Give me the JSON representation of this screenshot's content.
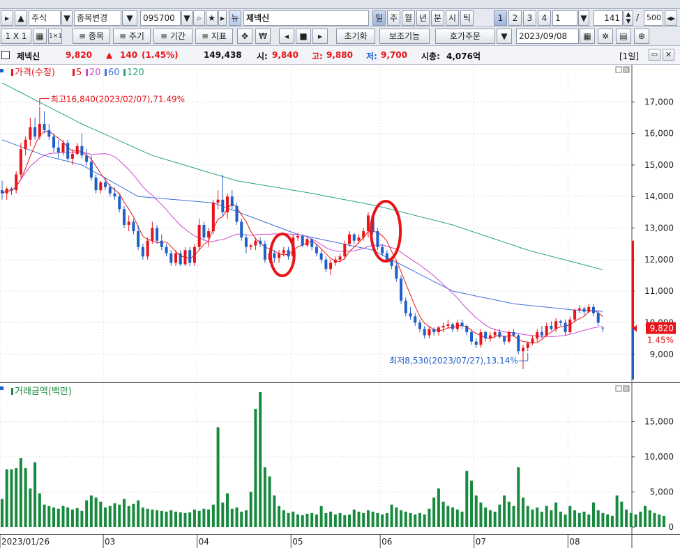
{
  "toolbar": {
    "market": "주식",
    "change_stock": "종목변경",
    "code": "095700",
    "name": "제넥신",
    "periods": [
      "일",
      "주",
      "월",
      "년",
      "분",
      "시",
      "틱"
    ],
    "num_buttons": [
      "1",
      "2",
      "3",
      "4"
    ],
    "interval": "1",
    "count": "141",
    "page_total": "500",
    "slash": "/"
  },
  "toolbar2": {
    "layout": "1 X 1",
    "stock": "종목",
    "cycle": "주기",
    "period": "기간",
    "indicator": "지표",
    "reset": "초기화",
    "aux": "보조기능",
    "order": "호가주문",
    "date": "2023/09/08"
  },
  "info": {
    "name": "제넥신",
    "price": "9,820",
    "arrow": "▲",
    "change": "140",
    "pct": "(1.45%)",
    "volume": "149,438",
    "open_label": "시:",
    "open": "9,840",
    "high_label": "고:",
    "high": "9,880",
    "low_label": "저:",
    "low": "9,700",
    "cap_label": "시총:",
    "cap": "4,076억",
    "period_tag": "[1일]"
  },
  "legend_price": {
    "title": "가격(수정)",
    "ma": [
      "5",
      "20",
      "60",
      "120"
    ]
  },
  "legend_volume": {
    "title": "거래금액(백만)"
  },
  "annotations": {
    "high": "최고16,840(2023/02/07),71.49%",
    "low": "최저8,530(2023/07/27),13.14%"
  },
  "current": {
    "price": "9,820",
    "pct": "1.45%"
  },
  "colors": {
    "up": "#e8141a",
    "down": "#1f5fc8",
    "ma5": "#e8141a",
    "ma20": "#d048d0",
    "ma60": "#3f73d8",
    "ma120": "#26a37b",
    "volume": "#178a3e"
  },
  "chart_data": [
    {
      "type": "candlestick",
      "title": "가격(수정)",
      "x_ticks": [
        "2023/01/26",
        "03",
        "04",
        "05",
        "06",
        "07",
        "08"
      ],
      "y_ticks": [
        "9,000",
        "10,000",
        "11,000",
        "12,000",
        "13,000",
        "14,000",
        "15,000",
        "16,000",
        "17,000"
      ],
      "ylim": [
        8200,
        18000
      ],
      "ohlc": [
        [
          14200,
          14500,
          13900,
          14100
        ],
        [
          14100,
          14300,
          13900,
          14250
        ],
        [
          14250,
          14300,
          14050,
          14200
        ],
        [
          14200,
          14800,
          14100,
          14700
        ],
        [
          14700,
          15700,
          14600,
          15500
        ],
        [
          15500,
          15900,
          15300,
          15800
        ],
        [
          15800,
          16500,
          15600,
          16200
        ],
        [
          16200,
          16500,
          15800,
          15900
        ],
        [
          15900,
          16840,
          15800,
          16300
        ],
        [
          16300,
          16700,
          16000,
          16100
        ],
        [
          16100,
          16300,
          15800,
          15900
        ],
        [
          15900,
          16000,
          15400,
          15550
        ],
        [
          15550,
          15800,
          15200,
          15400
        ],
        [
          15400,
          15800,
          15300,
          15700
        ],
        [
          15700,
          15800,
          15100,
          15200
        ],
        [
          15200,
          15500,
          15000,
          15350
        ],
        [
          15350,
          15700,
          15300,
          15600
        ],
        [
          15600,
          16000,
          15200,
          15300
        ],
        [
          15300,
          15500,
          15000,
          15100
        ],
        [
          15100,
          15300,
          14500,
          14600
        ],
        [
          14600,
          14700,
          14100,
          14200
        ],
        [
          14200,
          14500,
          14100,
          14450
        ],
        [
          14450,
          14600,
          14200,
          14300
        ],
        [
          14300,
          14400,
          14000,
          14100
        ],
        [
          14100,
          14300,
          13900,
          14000
        ],
        [
          14000,
          14100,
          13500,
          13600
        ],
        [
          13600,
          13700,
          13000,
          13100
        ],
        [
          13100,
          13400,
          12900,
          13200
        ],
        [
          13200,
          13300,
          12800,
          12900
        ],
        [
          12900,
          13100,
          12300,
          12400
        ],
        [
          12400,
          12500,
          12000,
          12100
        ],
        [
          12100,
          12700,
          12000,
          12600
        ],
        [
          12600,
          13200,
          12500,
          13000
        ],
        [
          13000,
          13100,
          12500,
          12600
        ],
        [
          12600,
          12800,
          12300,
          12400
        ],
        [
          12400,
          12500,
          12100,
          12200
        ],
        [
          12200,
          12300,
          11800,
          11900
        ],
        [
          11900,
          12300,
          11800,
          12200
        ],
        [
          12200,
          12300,
          11800,
          11850
        ],
        [
          11850,
          12400,
          11800,
          12300
        ],
        [
          12300,
          12400,
          11800,
          11900
        ],
        [
          11900,
          12500,
          11800,
          12400
        ],
        [
          12400,
          13300,
          12300,
          13100
        ],
        [
          13100,
          13200,
          12600,
          12700
        ],
        [
          12700,
          13000,
          12400,
          12900
        ],
        [
          12900,
          13900,
          12800,
          13800
        ],
        [
          13800,
          14200,
          13600,
          13900
        ],
        [
          13900,
          14700,
          13400,
          13500
        ],
        [
          13500,
          14100,
          13300,
          14000
        ],
        [
          14000,
          14200,
          13600,
          13700
        ],
        [
          13700,
          13800,
          13100,
          13200
        ],
        [
          13200,
          13300,
          12600,
          12700
        ],
        [
          12700,
          12800,
          12200,
          12400
        ],
        [
          12400,
          12500,
          12300,
          12450
        ],
        [
          12450,
          12700,
          12300,
          12600
        ],
        [
          12600,
          12700,
          12400,
          12500
        ],
        [
          12500,
          12600,
          11900,
          12000
        ],
        [
          12000,
          12300,
          11900,
          12200
        ],
        [
          12200,
          12300,
          11900,
          12050
        ],
        [
          12050,
          12300,
          11900,
          12200
        ],
        [
          12200,
          12400,
          12100,
          12300
        ],
        [
          12300,
          12400,
          12000,
          12100
        ],
        [
          12100,
          12800,
          12050,
          12700
        ],
        [
          12700,
          12850,
          12600,
          12750
        ],
        [
          12750,
          12800,
          12400,
          12450
        ],
        [
          12450,
          12700,
          12400,
          12650
        ],
        [
          12650,
          12700,
          12300,
          12400
        ],
        [
          12400,
          12500,
          12100,
          12200
        ],
        [
          12200,
          12300,
          11900,
          12000
        ],
        [
          12000,
          12100,
          11600,
          11700
        ],
        [
          11700,
          12000,
          11500,
          11900
        ],
        [
          11900,
          12100,
          11800,
          12000
        ],
        [
          12000,
          12200,
          11900,
          12100
        ],
        [
          12100,
          12600,
          12000,
          12500
        ],
        [
          12500,
          12900,
          12400,
          12800
        ],
        [
          12800,
          12850,
          12500,
          12600
        ],
        [
          12600,
          12800,
          12500,
          12700
        ],
        [
          12700,
          13000,
          12600,
          12900
        ],
        [
          12900,
          13500,
          12700,
          13400
        ],
        [
          13400,
          13450,
          12800,
          12900
        ],
        [
          12900,
          13000,
          12300,
          12400
        ],
        [
          12400,
          12500,
          12100,
          12200
        ],
        [
          12200,
          12300,
          11900,
          12000
        ],
        [
          12000,
          12100,
          11700,
          11800
        ],
        [
          11800,
          11900,
          11300,
          11400
        ],
        [
          11400,
          11500,
          10600,
          10700
        ],
        [
          10700,
          10800,
          10200,
          10300
        ],
        [
          10300,
          10500,
          10100,
          10200
        ],
        [
          10200,
          10300,
          9900,
          10000
        ],
        [
          10000,
          10100,
          9700,
          9800
        ],
        [
          9800,
          9900,
          9500,
          9600
        ],
        [
          9600,
          9900,
          9500,
          9800
        ],
        [
          9800,
          9850,
          9600,
          9700
        ],
        [
          9700,
          9900,
          9600,
          9850
        ],
        [
          9850,
          10000,
          9700,
          9900
        ],
        [
          9900,
          10100,
          9800,
          9950
        ],
        [
          9950,
          10000,
          9700,
          9800
        ],
        [
          9800,
          10100,
          9700,
          10000
        ],
        [
          10000,
          10100,
          9800,
          9900
        ],
        [
          9900,
          9950,
          9600,
          9700
        ],
        [
          9700,
          9750,
          9300,
          9400
        ],
        [
          9400,
          9500,
          9200,
          9300
        ],
        [
          9300,
          9800,
          9200,
          9700
        ],
        [
          9700,
          9750,
          9400,
          9500
        ],
        [
          9500,
          9700,
          9400,
          9600
        ],
        [
          9600,
          9800,
          9500,
          9700
        ],
        [
          9700,
          9800,
          9500,
          9550
        ],
        [
          9550,
          9600,
          9300,
          9400
        ],
        [
          9400,
          9750,
          9350,
          9700
        ],
        [
          9700,
          9800,
          9550,
          9600
        ],
        [
          9600,
          9650,
          9000,
          9100
        ],
        [
          9100,
          9300,
          8530,
          9200
        ],
        [
          9200,
          9400,
          9100,
          9350
        ],
        [
          9350,
          9600,
          9300,
          9500
        ],
        [
          9500,
          9800,
          9400,
          9700
        ],
        [
          9700,
          9900,
          9500,
          9600
        ],
        [
          9600,
          10000,
          9550,
          9900
        ],
        [
          9900,
          10050,
          9750,
          9800
        ],
        [
          9800,
          10150,
          9700,
          10050
        ],
        [
          10050,
          10100,
          9900,
          10000
        ],
        [
          10000,
          10100,
          9600,
          9700
        ],
        [
          9700,
          10200,
          9650,
          10100
        ],
        [
          10100,
          10450,
          10000,
          10400
        ],
        [
          10400,
          10550,
          10300,
          10450
        ],
        [
          10450,
          10500,
          10250,
          10350
        ],
        [
          10350,
          10600,
          10300,
          10500
        ],
        [
          10500,
          10600,
          10200,
          10300
        ],
        [
          10300,
          10400,
          9900,
          10000
        ],
        [
          9840,
          9880,
          9700,
          9820
        ]
      ],
      "ma_labels": [
        "5",
        "20",
        "60",
        "120"
      ],
      "ma60_anchors": [
        [
          0,
          15800
        ],
        [
          9,
          15300
        ],
        [
          17,
          15000
        ],
        [
          29,
          14000
        ],
        [
          45,
          13800
        ],
        [
          63,
          12800
        ],
        [
          79,
          12300
        ],
        [
          96,
          11000
        ],
        [
          109,
          10600
        ],
        [
          122,
          10400
        ],
        [
          130,
          10350
        ]
      ],
      "ma120_anchors": [
        [
          0,
          17600
        ],
        [
          17,
          16300
        ],
        [
          32,
          15300
        ],
        [
          50,
          14500
        ],
        [
          66,
          14100
        ],
        [
          80,
          13700
        ],
        [
          96,
          13100
        ],
        [
          112,
          12300
        ],
        [
          130,
          11600
        ]
      ]
    },
    {
      "type": "bar",
      "title": "거래금액(백만)",
      "y_ticks": [
        "0",
        "5,000",
        "10,000",
        "15,000"
      ],
      "ylim": [
        0,
        19500
      ],
      "values": [
        4000,
        8200,
        8200,
        8400,
        9800,
        8400,
        5500,
        9200,
        4800,
        3200,
        3000,
        2800,
        2600,
        3000,
        2800,
        2500,
        2700,
        2300,
        3800,
        4500,
        4200,
        3600,
        2800,
        3000,
        3400,
        3200,
        4000,
        3000,
        3300,
        3800,
        2800,
        2600,
        2500,
        2400,
        2300,
        2200,
        2400,
        2200,
        2100,
        2000,
        2100,
        2500,
        2300,
        2600,
        2500,
        3200,
        14200,
        3500,
        4800,
        2600,
        2800,
        2200,
        2400,
        5000,
        16800,
        19200,
        8500,
        7200,
        4500,
        3000,
        2400,
        2000,
        2200,
        1800,
        1700,
        1900,
        2000,
        1800,
        3000,
        2000,
        2200,
        1800,
        2000,
        1700,
        1800,
        2500,
        2200,
        2000,
        2400,
        2200,
        2000,
        1800,
        2000,
        3200,
        2800,
        2400,
        2200,
        2000,
        1800,
        2000,
        1800,
        2600,
        4200,
        5500,
        3600,
        3000,
        2800,
        2500,
        2200,
        8000,
        6600,
        4500,
        3500,
        2800,
        2400,
        2200,
        3200,
        4500,
        3600,
        3000,
        8500,
        4200,
        3000,
        2500,
        2800,
        2200,
        3000,
        2400,
        3500,
        2200,
        1800,
        3000,
        2400,
        2000,
        2200,
        1800,
        3500,
        2400,
        2000,
        1800,
        1600,
        4500,
        3600,
        2500,
        2000,
        1800,
        2200,
        3000,
        2400,
        2000,
        1800,
        1600
      ]
    }
  ]
}
